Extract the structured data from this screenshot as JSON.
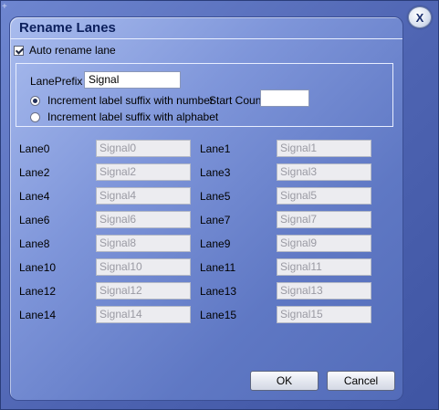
{
  "dialog": {
    "title": "Rename Lanes",
    "close_label": "X"
  },
  "auto_rename": {
    "label": "Auto rename lane",
    "checked": true
  },
  "prefix": {
    "label": "LanePrefix",
    "value": "Signal"
  },
  "options": {
    "number_label": "Increment label suffix with number",
    "alphabet_label": "Increment label suffix with alphabet",
    "selected": "number",
    "start_count_label": "Start Count",
    "start_count_value": ""
  },
  "lanes": [
    {
      "label": "Lane0",
      "value": "Signal0"
    },
    {
      "label": "Lane1",
      "value": "Signal1"
    },
    {
      "label": "Lane2",
      "value": "Signal2"
    },
    {
      "label": "Lane3",
      "value": "Signal3"
    },
    {
      "label": "Lane4",
      "value": "Signal4"
    },
    {
      "label": "Lane5",
      "value": "Signal5"
    },
    {
      "label": "Lane6",
      "value": "Signal6"
    },
    {
      "label": "Lane7",
      "value": "Signal7"
    },
    {
      "label": "Lane8",
      "value": "Signal8"
    },
    {
      "label": "Lane9",
      "value": "Signal9"
    },
    {
      "label": "Lane10",
      "value": "Signal10"
    },
    {
      "label": "Lane11",
      "value": "Signal11"
    },
    {
      "label": "Lane12",
      "value": "Signal12"
    },
    {
      "label": "Lane13",
      "value": "Signal13"
    },
    {
      "label": "Lane14",
      "value": "Signal14"
    },
    {
      "label": "Lane15",
      "value": "Signal15"
    }
  ],
  "buttons": {
    "ok": "OK",
    "cancel": "Cancel"
  }
}
